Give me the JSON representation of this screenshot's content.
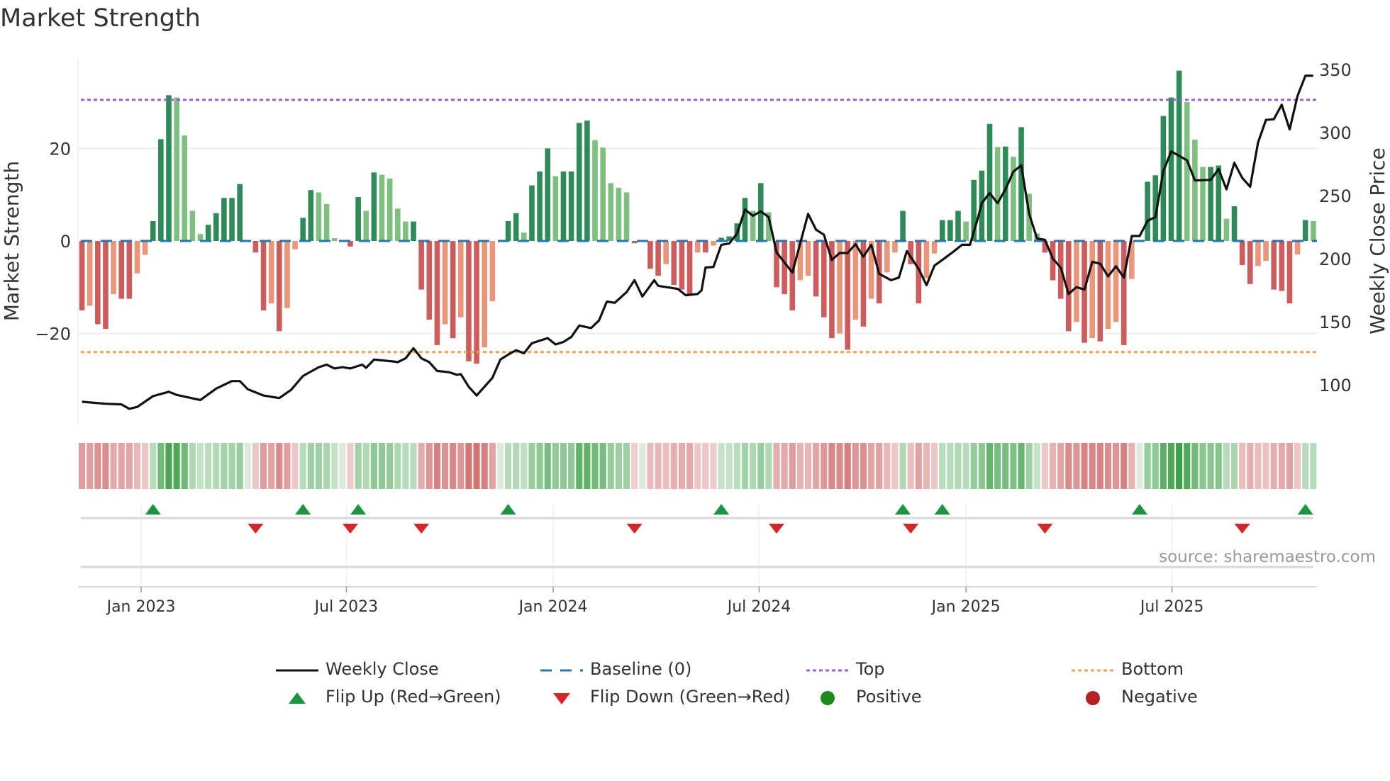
{
  "title": "Market Strength",
  "source": "source: sharemaestro.com",
  "colors": {
    "pos_rising": "#2e8b57",
    "pos_falling": "#7fbf7f",
    "neg_falling": "#cd5c5c",
    "neg_rising": "#e9967a",
    "close": "#111111",
    "baseline": "#1f77b4",
    "top": "#9b5fd6",
    "bottom": "#f0a050",
    "flip_up": "#1a9641",
    "flip_down": "#d62728",
    "positive": "#1e8a1e",
    "negative": "#b22222"
  },
  "legend": [
    {
      "label": "Weekly Close",
      "symbol": "solid-line",
      "color": "#111111"
    },
    {
      "label": "Baseline (0)",
      "symbol": "dashed-line",
      "color": "#1f77b4"
    },
    {
      "label": "Top",
      "symbol": "dotted-line",
      "color": "#9b5fd6"
    },
    {
      "label": "Bottom",
      "symbol": "dotted-line",
      "color": "#f0a050"
    },
    {
      "label": "Flip Up (Red→Green)",
      "symbol": "triangle-up",
      "color": "#1a9641"
    },
    {
      "label": "Flip Down (Green→Red)",
      "symbol": "triangle-down",
      "color": "#d62728"
    },
    {
      "label": "Positive",
      "symbol": "dot",
      "color": "#1e8a1e"
    },
    {
      "label": "Negative",
      "symbol": "dot",
      "color": "#b22222"
    }
  ],
  "chart_data": {
    "type": "bar",
    "title": "Market Strength",
    "ylabel": "Market Strength",
    "y2label": "Weekly Close Price",
    "ylim": [
      -40,
      40
    ],
    "y2lim": [
      73,
      367
    ],
    "yticks": [
      20,
      0,
      -20
    ],
    "ytick_labels": [
      "20",
      "0",
      "−20"
    ],
    "y2ticks": [
      100,
      150,
      200,
      250,
      300,
      350
    ],
    "y2tick_labels": [
      "100",
      "150",
      "200",
      "250",
      "300",
      "350"
    ],
    "top_level": 30.5,
    "bottom_level": -24,
    "baseline": 0,
    "x_unit": "week index (weekly bars, Nov 2022 – Nov 2025)",
    "xticks": [
      {
        "label": "Jan 2023",
        "week": 8.0
      },
      {
        "label": "Jul 2023",
        "week": 34.0
      },
      {
        "label": "Jan 2024",
        "week": 60.2
      },
      {
        "label": "Jul 2024",
        "week": 86.3
      },
      {
        "label": "Jan 2025",
        "week": 112.5
      },
      {
        "label": "Jul 2025",
        "week": 138.6
      }
    ],
    "strength": [
      -15,
      -14,
      -18,
      -19,
      -11.5,
      -12.5,
      -12.5,
      -7,
      -3,
      4.3,
      22,
      31.5,
      31,
      22.8,
      6.5,
      1.5,
      3.5,
      6,
      9.3,
      9.3,
      12.3,
      0,
      -2.5,
      -15,
      -13.5,
      -19.5,
      -14.5,
      -1.8,
      5,
      11,
      10.5,
      8,
      0.6,
      0,
      -1.2,
      9.5,
      6.5,
      14.8,
      14.3,
      13.5,
      7,
      4.2,
      4.2,
      -10.5,
      -17,
      -22.5,
      -18,
      -21,
      -16.5,
      -26,
      -26.5,
      -23,
      -13,
      0,
      4.3,
      6,
      1.8,
      12,
      15,
      20,
      14,
      15,
      15,
      25.5,
      26,
      21.8,
      20.2,
      12.5,
      11.5,
      10.5,
      -0.5,
      0,
      -6,
      -7.5,
      -5,
      -9.5,
      -10.5,
      -11.5,
      -2.5,
      -2.5,
      -1,
      0.7,
      1,
      3.8,
      9.3,
      6.5,
      12.5,
      6.2,
      -10,
      -11.5,
      -15,
      -8.5,
      -7.5,
      -12,
      -16.5,
      -21,
      -20,
      -23.5,
      -17,
      -18.5,
      -12.5,
      -13.5,
      -6.8,
      -2.5,
      6.5,
      -5,
      -13.5,
      -8,
      -2.7,
      4.5,
      4.5,
      6.5,
      4.2,
      13.2,
      15.2,
      25.3,
      20.3,
      20.4,
      18.2,
      24.6,
      10.2,
      1.6,
      -2.5,
      -8.5,
      -12.5,
      -19.5,
      -17.5,
      -22,
      -21,
      -21.7,
      -19,
      -17.5,
      -22.5,
      -8.2,
      0,
      12.8,
      14.2,
      27,
      31,
      36.8,
      30,
      21.9,
      16,
      16,
      16.3,
      4.8,
      7.5,
      -5.2,
      -9.3,
      -5.4,
      -4.3,
      -10.5,
      -10.8,
      -13.5,
      -2.9,
      4.5,
      4.3
    ],
    "close_points": [
      [
        0,
        86.6
      ],
      [
        3,
        85
      ],
      [
        5,
        84.5
      ],
      [
        6,
        81
      ],
      [
        7,
        82.5
      ],
      [
        9,
        91
      ],
      [
        11,
        94.5
      ],
      [
        12,
        92
      ],
      [
        15,
        88
      ],
      [
        17,
        97
      ],
      [
        19,
        103
      ],
      [
        20,
        103
      ],
      [
        21,
        96.5
      ],
      [
        23,
        91.5
      ],
      [
        25,
        89.5
      ],
      [
        26.5,
        96
      ],
      [
        28,
        107
      ],
      [
        30,
        114
      ],
      [
        31,
        116
      ],
      [
        32,
        113
      ],
      [
        33,
        114
      ],
      [
        34,
        113
      ],
      [
        35.5,
        116
      ],
      [
        36,
        113.5
      ],
      [
        37,
        120
      ],
      [
        39.5,
        118.5
      ],
      [
        40,
        118
      ],
      [
        41,
        121
      ],
      [
        42,
        129
      ],
      [
        43,
        121
      ],
      [
        44,
        118
      ],
      [
        45,
        111
      ],
      [
        46.5,
        110
      ],
      [
        47.5,
        108
      ],
      [
        48,
        108.5
      ],
      [
        49,
        98.5
      ],
      [
        50,
        91.5
      ],
      [
        52,
        105.5
      ],
      [
        53,
        120
      ],
      [
        54,
        124
      ],
      [
        55,
        127.5
      ],
      [
        56,
        125
      ],
      [
        57,
        133
      ],
      [
        59,
        137
      ],
      [
        60,
        132
      ],
      [
        61,
        134
      ],
      [
        62,
        138
      ],
      [
        63,
        147
      ],
      [
        64.5,
        145
      ],
      [
        65.5,
        151
      ],
      [
        66.5,
        166
      ],
      [
        67.5,
        165
      ],
      [
        69,
        173.5
      ],
      [
        70,
        183
      ],
      [
        71,
        170
      ],
      [
        72.5,
        183
      ],
      [
        73,
        178.5
      ],
      [
        75.5,
        176
      ],
      [
        76.5,
        171
      ],
      [
        78,
        172
      ],
      [
        78.5,
        175
      ],
      [
        79,
        193
      ],
      [
        80,
        193.5
      ],
      [
        81,
        211
      ],
      [
        82,
        212
      ],
      [
        83,
        220
      ],
      [
        84,
        239
      ],
      [
        85,
        234
      ],
      [
        86,
        237.5
      ],
      [
        87,
        233
      ],
      [
        88,
        205
      ],
      [
        90,
        189
      ],
      [
        92,
        235.5
      ],
      [
        93,
        223
      ],
      [
        94,
        219
      ],
      [
        95,
        199
      ],
      [
        96,
        204.5
      ],
      [
        97,
        204.5
      ],
      [
        98,
        211.5
      ],
      [
        99,
        201.5
      ],
      [
        100,
        211
      ],
      [
        101,
        188
      ],
      [
        102.5,
        183
      ],
      [
        103.5,
        185
      ],
      [
        104.5,
        206
      ],
      [
        106,
        192
      ],
      [
        107,
        179
      ],
      [
        108,
        194.5
      ],
      [
        109,
        199
      ],
      [
        110.5,
        206
      ],
      [
        111.5,
        211
      ],
      [
        112.5,
        211
      ],
      [
        113.5,
        232
      ],
      [
        114,
        244
      ],
      [
        115,
        252
      ],
      [
        116,
        244
      ],
      [
        117,
        255
      ],
      [
        118,
        269
      ],
      [
        119,
        274
      ],
      [
        120,
        235.5
      ],
      [
        121,
        216
      ],
      [
        122,
        215
      ],
      [
        123,
        200
      ],
      [
        124,
        193
      ],
      [
        125,
        172
      ],
      [
        126,
        177.5
      ],
      [
        127,
        175.5
      ],
      [
        128,
        197.5
      ],
      [
        129,
        196
      ],
      [
        130,
        186
      ],
      [
        131,
        194
      ],
      [
        132,
        185
      ],
      [
        133,
        218
      ],
      [
        134,
        218
      ],
      [
        135,
        230
      ],
      [
        136,
        233
      ],
      [
        137,
        269.5
      ],
      [
        138,
        285
      ],
      [
        139,
        281.5
      ],
      [
        140,
        278
      ],
      [
        141,
        262
      ],
      [
        143,
        262.5
      ],
      [
        144,
        271
      ],
      [
        145,
        255
      ],
      [
        146,
        276
      ],
      [
        147,
        264
      ],
      [
        148,
        257
      ],
      [
        149,
        292
      ],
      [
        150,
        310
      ],
      [
        151,
        310.5
      ],
      [
        152,
        322
      ],
      [
        153,
        302.5
      ],
      [
        154,
        329
      ],
      [
        155,
        345
      ],
      [
        156,
        345
      ]
    ],
    "flip_up_weeks": [
      9,
      28,
      35,
      54,
      81,
      104,
      109,
      134,
      155
    ],
    "flip_down_weeks": [
      22,
      34,
      43,
      70,
      88,
      105,
      122,
      147
    ],
    "legend_position": "bottom"
  }
}
